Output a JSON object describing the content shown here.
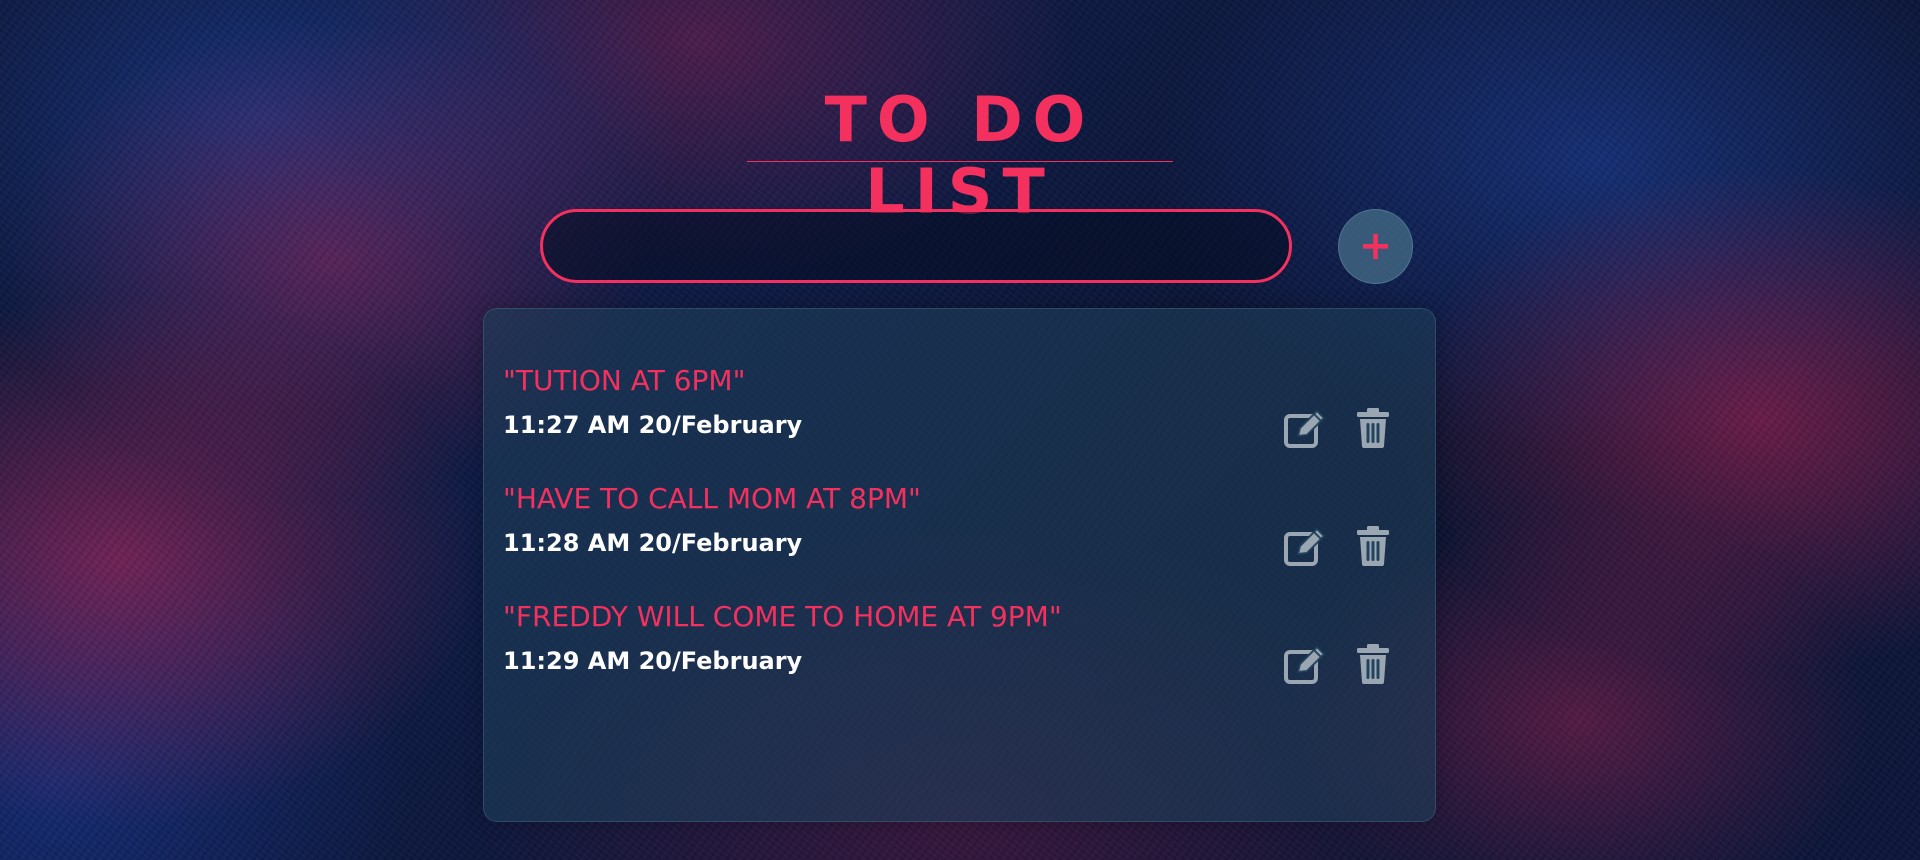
{
  "app": {
    "title": "TO DO LIST"
  },
  "input": {
    "value": "",
    "placeholder": ""
  },
  "add_button": {
    "label": "+",
    "icon": "plus-icon"
  },
  "tasks": [
    {
      "text": "\"TUTION AT 6PM\"",
      "time": "11:27 AM 20/February",
      "edit_icon": "edit-icon",
      "delete_icon": "trash-icon"
    },
    {
      "text": "\"HAVE TO CALL MOM AT 8PM\"",
      "time": "11:28 AM 20/February",
      "edit_icon": "edit-icon",
      "delete_icon": "trash-icon"
    },
    {
      "text": "\"FREDDY WILL COME TO HOME AT 9PM\"",
      "time": "11:29 AM 20/February",
      "edit_icon": "edit-icon",
      "delete_icon": "trash-icon"
    }
  ],
  "colors": {
    "accent": "#f4305f",
    "icon": "#9aa6b2",
    "time_text": "#ffffff",
    "panel": "#1e3e58",
    "add_button_bg": "#466e87"
  }
}
